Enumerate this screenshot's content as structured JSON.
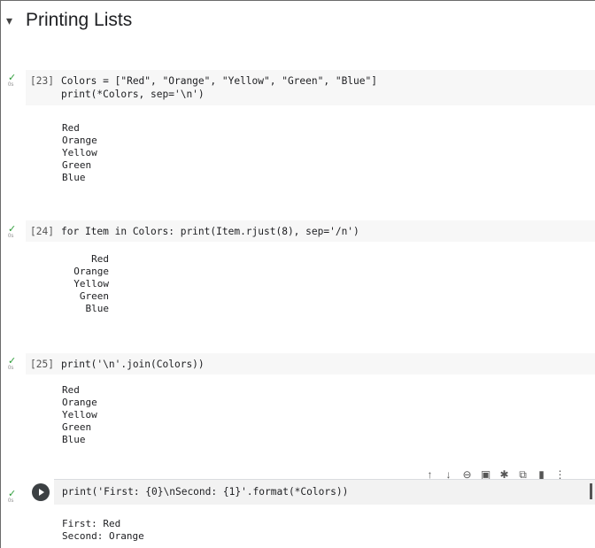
{
  "section": {
    "title": "Printing Lists"
  },
  "status": {
    "check": "✓",
    "secs": "0s"
  },
  "cells": [
    {
      "count": "[23]",
      "code_line1": "Colors = [\"Red\", \"Orange\", \"Yellow\", \"Green\", \"Blue\"]",
      "code_line2": "print(*Colors, sep='\\n')",
      "output": "Red\nOrange\nYellow\nGreen\nBlue"
    },
    {
      "count": "[24]",
      "code_line1": "for Item in Colors: print(Item.rjust(8), sep='/n')",
      "output": "     Red\n  Orange\n  Yellow\n   Green\n    Blue"
    },
    {
      "count": "[25]",
      "code_line1": "print('\\n'.join(Colors))",
      "output": "Red\nOrange\nYellow\nGreen\nBlue"
    },
    {
      "count": "",
      "code_line1": "print('First: {0}\\nSecond: {1}'.format(*Colors))",
      "output": "First: Red\nSecond: Orange"
    }
  ],
  "toolbar": {
    "icons": [
      "arrow-up-icon",
      "arrow-down-icon",
      "link-icon",
      "comment-icon",
      "gear-icon",
      "mirror-cell-icon",
      "delete-icon",
      "more-icon"
    ],
    "glyphs": [
      "↑",
      "↓",
      "⊖",
      "▣",
      "✱",
      "⧉",
      "▮",
      "⋮"
    ]
  },
  "colors": {
    "check": "#2e9d3a",
    "string": "#a31515",
    "keyword": "#0000ff",
    "code_bg": "#f7f7f7"
  }
}
